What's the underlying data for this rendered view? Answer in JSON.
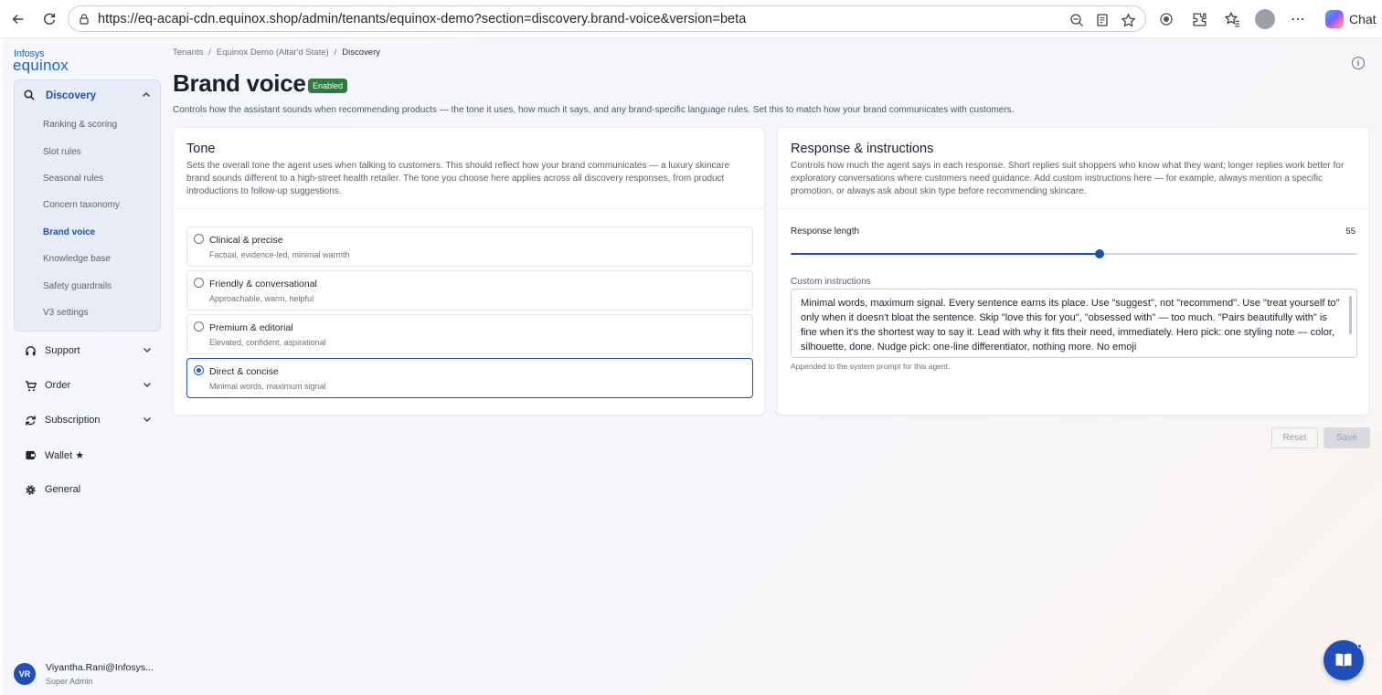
{
  "browser": {
    "url": "https://eq-acapi-cdn.equinox.shop/admin/tenants/equinox-demo?section=discovery.brand-voice&version=beta",
    "chat_label": "Chat"
  },
  "brand": {
    "small": "Infosys",
    "big": "equinox"
  },
  "sidebar": {
    "open_group": {
      "label": "Discovery",
      "items": [
        "Ranking & scoring",
        "Slot rules",
        "Seasonal rules",
        "Concern taxonomy",
        "Brand voice",
        "Knowledge base",
        "Safety guardrails",
        "V3 settings"
      ],
      "active": "Brand voice"
    },
    "groups": [
      {
        "label": "Support",
        "icon": "headset-icon"
      },
      {
        "label": "Order",
        "icon": "cart-icon"
      },
      {
        "label": "Subscription",
        "icon": "refresh-icon"
      },
      {
        "label": "Wallet ★",
        "icon": "wallet-icon"
      },
      {
        "label": "General",
        "icon": "gear-icon"
      }
    ],
    "user": {
      "initials": "VR",
      "name": "Viyantha.Rani@Infosys...",
      "role": "Super Admin"
    }
  },
  "breadcrumb": {
    "items": [
      "Tenants",
      "Equinox Demo (Altar'd State)",
      "Discovery"
    ],
    "separator": "/"
  },
  "page": {
    "title": "Brand voice",
    "badge": "Enabled",
    "description": "Controls how the assistant sounds when recommending products — the tone it uses, how much it says, and any brand-specific language rules. Set this to match how your brand communicates with customers."
  },
  "tone": {
    "title": "Tone",
    "description": "Sets the overall tone the agent uses when talking to customers. This should reflect how your brand communicates — a luxury skincare brand sounds different to a high-street health retailer. The tone you choose here applies across all discovery responses, from product introductions to follow-up suggestions.",
    "options": [
      {
        "label": "Clinical & precise",
        "sub": "Factual, evidence-led, minimal warmth"
      },
      {
        "label": "Friendly & conversational",
        "sub": "Approachable, warm, helpful"
      },
      {
        "label": "Premium & editorial",
        "sub": "Elevated, confident, aspirational"
      },
      {
        "label": "Direct & concise",
        "sub": "Minimal words, maximum signal"
      }
    ],
    "selected": "Direct & concise"
  },
  "response": {
    "title": "Response & instructions",
    "description": "Controls how much the agent says in each response. Short replies suit shoppers who know what they want; longer replies work better for exploratory conversations where customers need guidance. Add custom instructions here — for example, always mention a specific promotion, or always ask about skin type before recommending skincare.",
    "length_label": "Response length",
    "length_value": "55",
    "slider_fraction": 0.545,
    "custom_label": "Custom instructions",
    "custom_value": "Minimal words, maximum signal. Every sentence earns its place. Use \"suggest\", not \"recommend\". Use \"treat yourself to\" only when it doesn't bloat the sentence. Skip \"love this for you\", \"obsessed with\" — too much. \"Pairs beautifully with\" is fine when it's the shortest way to say it. Lead with why it fits their need, immediately. Hero pick: one styling note — color, silhouette, done. Nudge pick: one-line differentiator, nothing more. No emoji",
    "custom_help": "Appended to the system prompt for this agent."
  },
  "actions": {
    "reset": "Reset",
    "save": "Save"
  },
  "colors": {
    "accent": "#1d4fb0",
    "badge": "#2a7d3e"
  }
}
